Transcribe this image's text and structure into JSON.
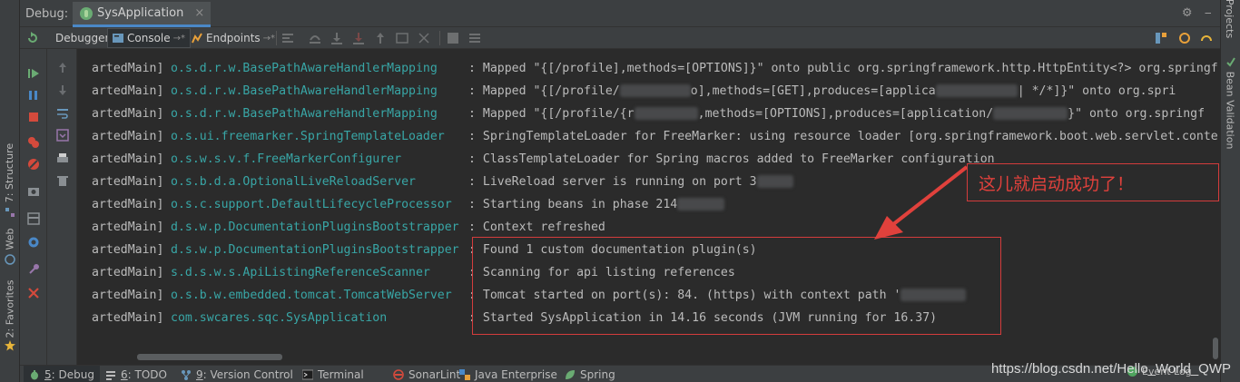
{
  "title_bar": {
    "label": "Debug:",
    "session_tab": "SysApplication",
    "close_glyph": "×"
  },
  "toolbar": {
    "debugger_tab": "Debugger",
    "console_tab": "Console",
    "endpoints_tab": "Endpoints",
    "pin_glyph": "→*"
  },
  "left_strip": {
    "structure_tab": "7: Structure",
    "web_tab": "Web",
    "favorites_tab": "2: Favorites"
  },
  "right_strip": {
    "projects_tab": "Projects",
    "bean_validation_tab": "Bean Validation"
  },
  "console": {
    "lines": [
      {
        "thread": "artedMain]",
        "logger": "o.s.d.r.w.BasePathAwareHandlerMapping",
        "msg": ": Mapped \"{[/profile],methods=[OPTIONS]}\" onto public org.springframework.http.HttpEntity<?> org.springf"
      },
      {
        "thread": "artedMain]",
        "logger": "o.s.d.r.w.BasePathAwareHandlerMapping",
        "msg": ": Mapped \"{[/profile/",
        "msg_b": "o",
        "msg_c": "],methods=[GET],produces=[applica",
        "msg_d": "| */*]}\" onto org.spri"
      },
      {
        "thread": "artedMain]",
        "logger": "o.s.d.r.w.BasePathAwareHandlerMapping",
        "msg": ": Mapped \"{[/profile/{r",
        "msg_c": ",methods=[OPTIONS],produces=[application/",
        "msg_d": "}\" onto org.springf"
      },
      {
        "thread": "artedMain]",
        "logger": "o.s.ui.freemarker.SpringTemplateLoader",
        "msg": ": SpringTemplateLoader for FreeMarker: using resource loader [org.springframework.boot.web.servlet.conte"
      },
      {
        "thread": "artedMain]",
        "logger": "o.s.w.s.v.f.FreeMarkerConfigurer",
        "msg": ": ClassTemplateLoader for Spring macros added to FreeMarker configuration"
      },
      {
        "thread": "artedMain]",
        "logger": "o.s.b.d.a.OptionalLiveReloadServer",
        "msg": ": LiveReload server is running on port 3"
      },
      {
        "thread": "artedMain]",
        "logger": "o.s.c.support.DefaultLifecycleProcessor",
        "msg": ": Starting beans in phase 214"
      },
      {
        "thread": "artedMain]",
        "logger": "d.s.w.p.DocumentationPluginsBootstrapper",
        "msg": ": Context refreshed"
      },
      {
        "thread": "artedMain]",
        "logger": "d.s.w.p.DocumentationPluginsBootstrapper",
        "msg": ": Found 1 custom documentation plugin(s)"
      },
      {
        "thread": "artedMain]",
        "logger": "s.d.s.w.s.ApiListingReferenceScanner",
        "msg": ": Scanning for api listing references"
      },
      {
        "thread": "artedMain]",
        "logger": "o.s.b.w.embedded.tomcat.TomcatWebServer",
        "msg": ": Tomcat started on port(s): 84",
        "msg_c": ". (https) with context path '"
      },
      {
        "thread": "artedMain]",
        "logger": "com.swcares.sqc.SysApplication",
        "msg": ": Started SysApplication in 14.16 seconds (JVM running for 16.37)"
      }
    ],
    "annotation": "这儿就启动成功了！"
  },
  "bottom_bar": {
    "items": [
      {
        "mn": "5",
        "label": ": Debug"
      },
      {
        "mn": "6",
        "label": ": TODO"
      },
      {
        "mn": "9",
        "label": ": Version Control"
      },
      {
        "mn": "",
        "label": "Terminal"
      },
      {
        "mn": "",
        "label": "SonarLint"
      },
      {
        "mn": "",
        "label": "Java Enterprise"
      },
      {
        "mn": "",
        "label": "Spring"
      }
    ],
    "event_log": "Event Log",
    "watermark": "https://blog.csdn.net/Hello_World_QWP"
  },
  "colors": {
    "background": "#2b2b2b",
    "panel": "#3c3f41",
    "logger_teal": "#38a6a6",
    "annotation_red": "#d43c3c"
  }
}
